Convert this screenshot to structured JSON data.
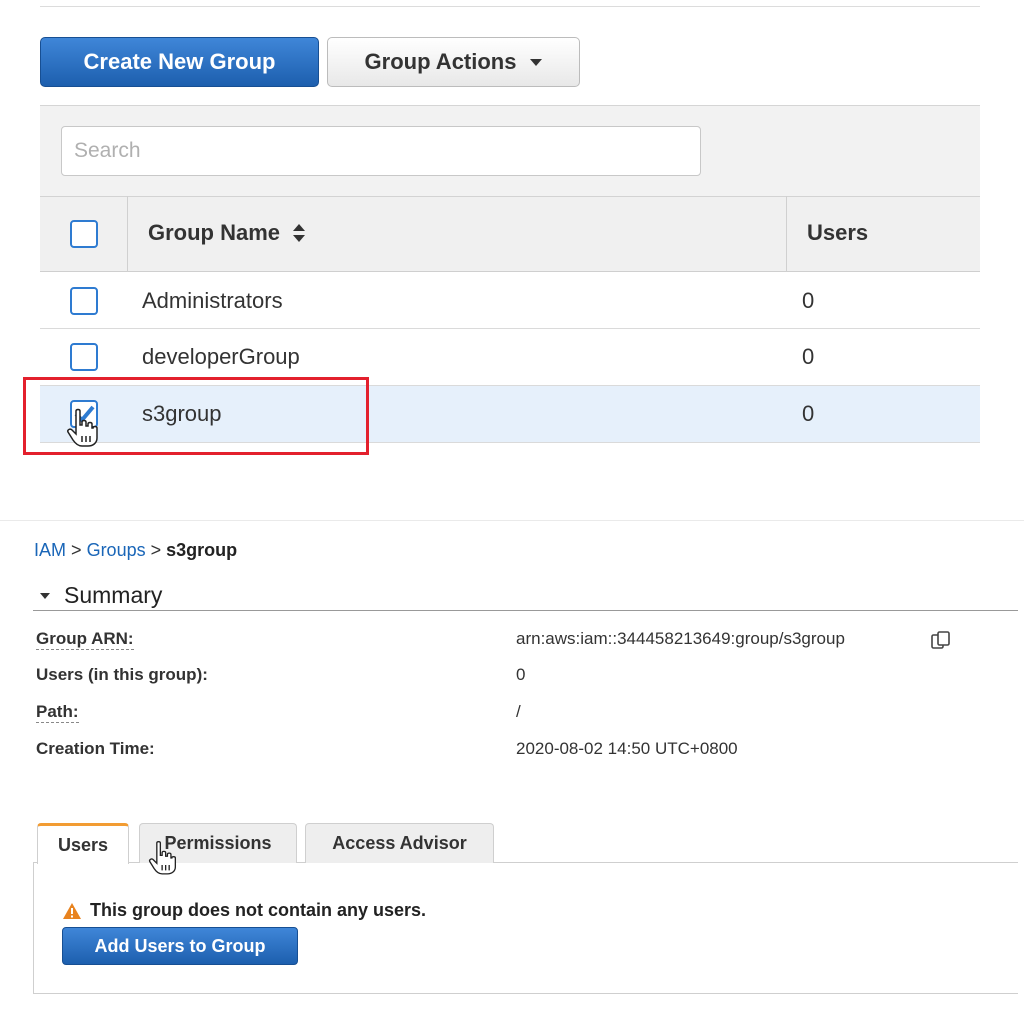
{
  "toolbar": {
    "create_label": "Create New Group",
    "actions_label": "Group Actions"
  },
  "search": {
    "placeholder": "Search"
  },
  "table": {
    "headers": {
      "name": "Group Name",
      "users": "Users"
    },
    "rows": [
      {
        "name": "Administrators",
        "users": "0",
        "checked": false
      },
      {
        "name": "developerGroup",
        "users": "0",
        "checked": false
      },
      {
        "name": "s3group",
        "users": "0",
        "checked": true
      }
    ]
  },
  "breadcrumb": {
    "root": "IAM",
    "sep": ">",
    "section": "Groups",
    "current": "s3group"
  },
  "summary": {
    "title": "Summary",
    "fields": [
      {
        "label": "Group ARN:",
        "value": "arn:aws:iam::344458213649:group/s3group"
      },
      {
        "label": "Users (in this group):",
        "value": "0"
      },
      {
        "label": "Path:",
        "value": "/"
      },
      {
        "label": "Creation Time:",
        "value": "2020-08-02 14:50 UTC+0800"
      }
    ]
  },
  "tabs": [
    {
      "label": "Users",
      "active": true
    },
    {
      "label": "Permissions",
      "active": false
    },
    {
      "label": "Access Advisor",
      "active": false
    }
  ],
  "users_tab": {
    "warning": "This group does not contain any users.",
    "add_button": "Add Users to Group"
  },
  "colors": {
    "primary": "#2a6fc0",
    "highlight": "#e3202d",
    "tab_accent": "#f29c33",
    "warning": "#e8831f"
  }
}
